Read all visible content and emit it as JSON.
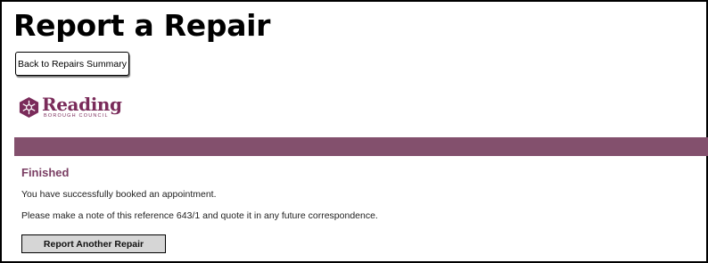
{
  "page": {
    "title": "Report a Repair"
  },
  "toolbar": {
    "back_label": "Back to Repairs Summary"
  },
  "brand": {
    "name": "Reading",
    "subtitle": "BOROUGH COUNCIL",
    "color": "#7a2b5a",
    "band_color": "#83506d"
  },
  "confirmation": {
    "heading": "Finished",
    "message": "You have successfully booked an appointment.",
    "reference_note": "Please make a note of this reference 643/1 and quote it in any future correspondence.",
    "new_repair_label": "Report Another Repair"
  }
}
